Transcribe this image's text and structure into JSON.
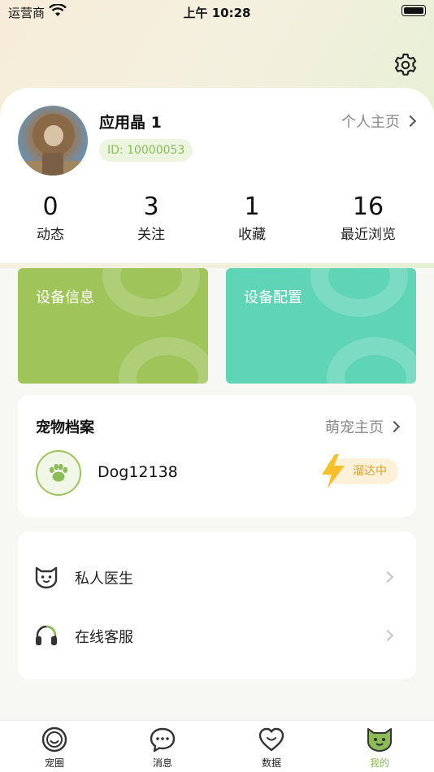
{
  "status_bar": {
    "carrier": "运营商",
    "time": "上午 10:28"
  },
  "profile": {
    "name": "应用晶 1",
    "id_text": "ID: 10000053",
    "homepage_label": "个人主页"
  },
  "stats": [
    {
      "value": "0",
      "label": "动态"
    },
    {
      "value": "3",
      "label": "关注"
    },
    {
      "value": "1",
      "label": "收藏"
    },
    {
      "value": "16",
      "label": "最近浏览"
    }
  ],
  "device_cards": [
    {
      "title": "设备信息",
      "color": "#9fc45a"
    },
    {
      "title": "设备配置",
      "color": "#5fd4b6"
    }
  ],
  "pet_section": {
    "title": "宠物档案",
    "link_label": "萌宠主页",
    "pet_name": "Dog12138",
    "status": "溜达中"
  },
  "menu": [
    {
      "label": "私人医生",
      "icon": "cat-face-icon"
    },
    {
      "label": "在线客服",
      "icon": "headset-icon"
    }
  ],
  "tabs": [
    {
      "label": "宠圈",
      "icon": "smile-circle-icon",
      "active": false
    },
    {
      "label": "消息",
      "icon": "chat-bubble-icon",
      "active": false
    },
    {
      "label": "数据",
      "icon": "heart-icon",
      "active": false
    },
    {
      "label": "我的",
      "icon": "pet-face-icon",
      "active": true
    }
  ],
  "colors": {
    "accent": "#8cbc58",
    "status_bg": "#fdf1d9",
    "status_text": "#e0a020"
  }
}
